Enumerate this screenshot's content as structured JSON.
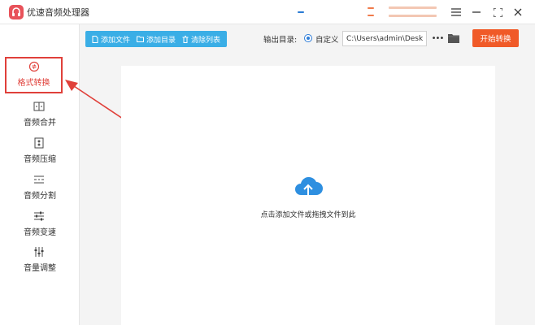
{
  "app": {
    "title": "优速音频处理器"
  },
  "toolbar": {
    "add_file_label": "添加文件",
    "add_folder_label": "添加目录",
    "clear_list_label": "清除列表",
    "output_label": "输出目录:",
    "custom_label": "自定义",
    "output_path": "C:\\Users\\admin\\Deskto",
    "more_label": "•••",
    "start_label": "开始转换"
  },
  "sidebar": {
    "items": [
      {
        "label": "格式转换",
        "icon": "format-convert-icon",
        "active": true
      },
      {
        "label": "音频合并",
        "icon": "merge-icon"
      },
      {
        "label": "音频压缩",
        "icon": "compress-icon"
      },
      {
        "label": "音频分割",
        "icon": "split-icon"
      },
      {
        "label": "音频变速",
        "icon": "speed-icon"
      },
      {
        "label": "音量调整",
        "icon": "volume-adjust-icon"
      }
    ]
  },
  "main": {
    "drop_hint": "点击添加文件或拖拽文件到此"
  },
  "colors": {
    "accent_blue": "#3aaee6",
    "start_orange": "#f05a28",
    "highlight_red": "#e0403a",
    "logo_red": "#e8525a"
  }
}
